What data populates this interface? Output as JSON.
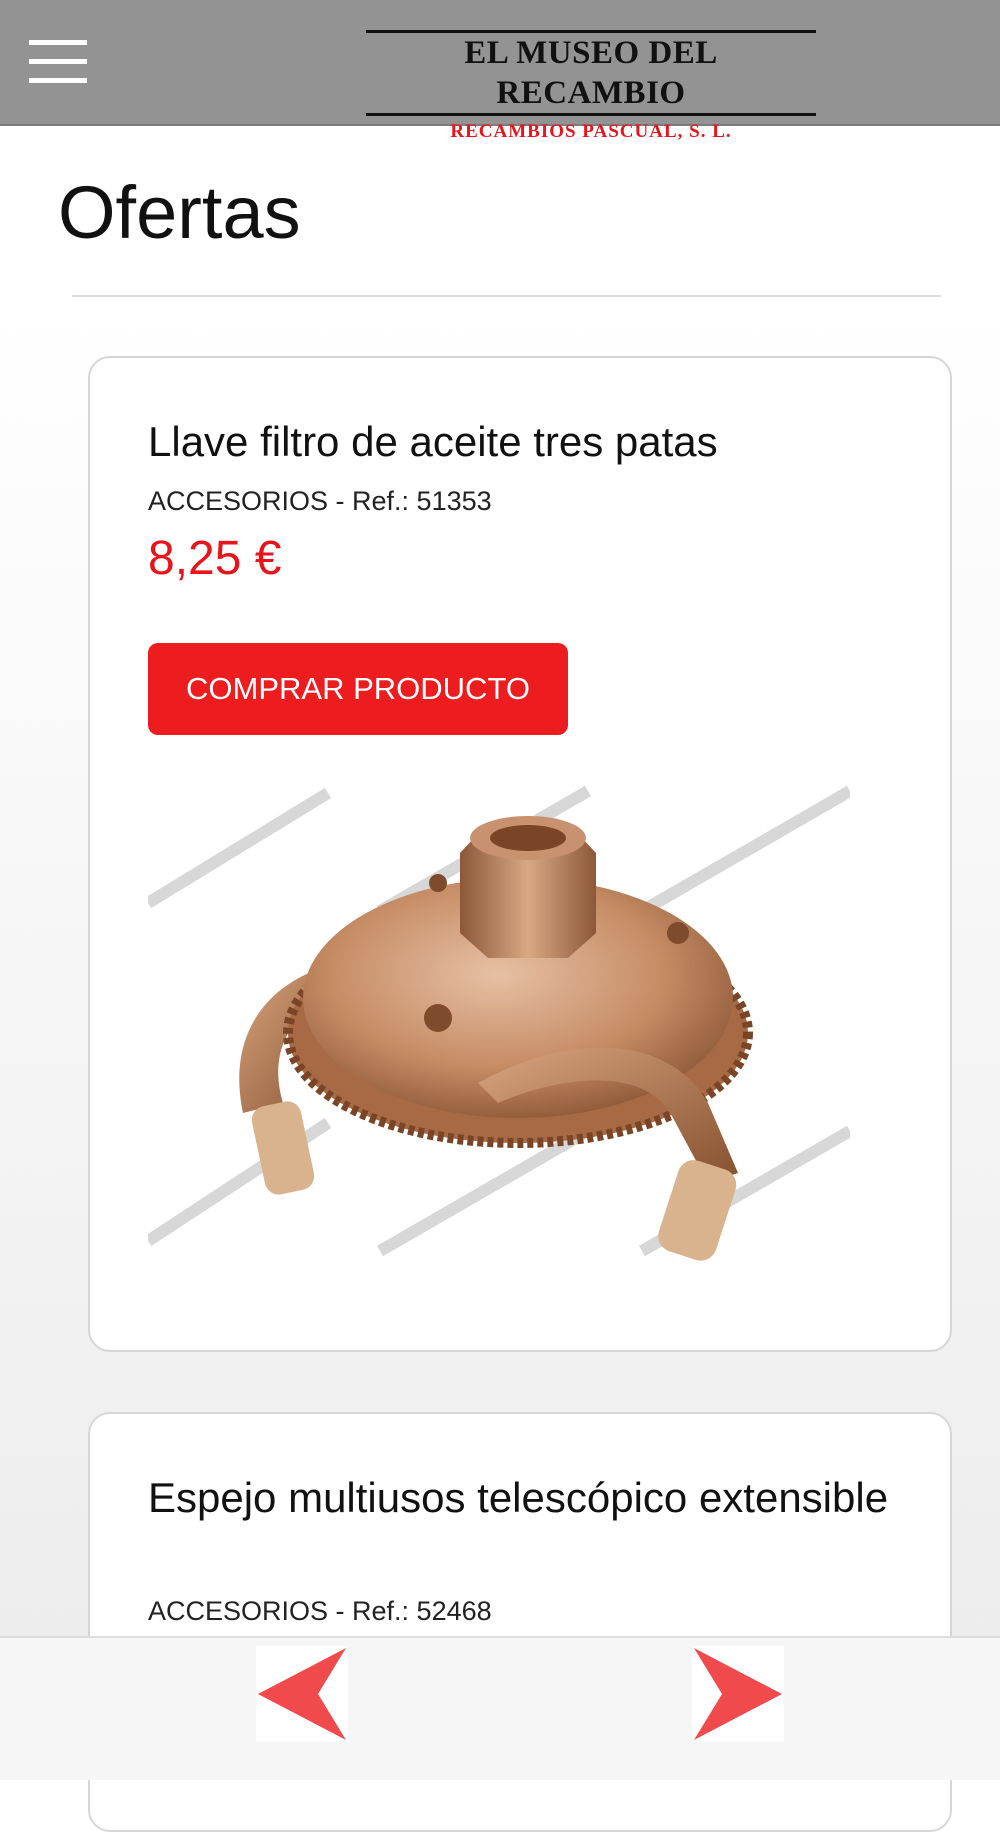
{
  "header": {
    "menu_icon": "hamburger-menu-icon",
    "logo_title": "EL MUSEO DEL RECAMBIO",
    "logo_subtitle": "RECAMBIOS PASCUAL, S. L."
  },
  "page": {
    "title": "Ofertas"
  },
  "products": [
    {
      "name": "Llave filtro de aceite tres patas",
      "meta": "ACCESORIOS - Ref.: 51353",
      "price": "8,25 €",
      "button_label": "COMPRAR PRODUCTO"
    },
    {
      "name": "Espejo multiusos telescópico extensible",
      "meta": "ACCESORIOS - Ref.: 52468"
    }
  ],
  "navigation": {
    "prev_icon": "arrow-left-icon",
    "next_icon": "arrow-right-icon"
  },
  "colors": {
    "header_bg": "#939393",
    "accent_red": "#e8141c",
    "nav_arrow": "#f04a4c"
  }
}
